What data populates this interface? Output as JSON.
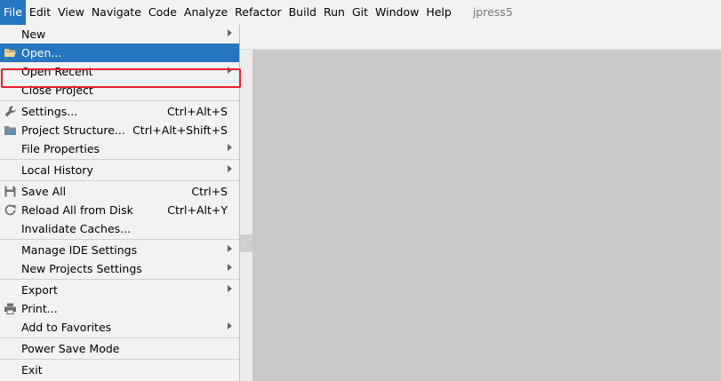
{
  "menubar": {
    "items": [
      "File",
      "Edit",
      "View",
      "Navigate",
      "Code",
      "Analyze",
      "Refactor",
      "Build",
      "Run",
      "Git",
      "Window",
      "Help"
    ],
    "project": "jpress5"
  },
  "file_menu": {
    "new": "New",
    "open": "Open...",
    "open_recent": "Open Recent",
    "close_project": "Close Project",
    "settings": "Settings...",
    "settings_sc": "Ctrl+Alt+S",
    "project_structure": "Project Structure...",
    "project_structure_sc": "Ctrl+Alt+Shift+S",
    "file_properties": "File Properties",
    "local_history": "Local History",
    "save_all": "Save All",
    "save_all_sc": "Ctrl+S",
    "reload": "Reload All from Disk",
    "reload_sc": "Ctrl+Alt+Y",
    "invalidate": "Invalidate Caches...",
    "manage_ide": "Manage IDE Settings",
    "new_projects_settings": "New Projects Settings",
    "export": "Export",
    "print": "Print...",
    "add_favorites": "Add to Favorites",
    "power_save": "Power Save Mode",
    "exit": "Exit"
  },
  "icons": {
    "open": "folder-open-icon",
    "settings": "wrench-icon",
    "project_structure": "project-structure-icon",
    "save_all": "save-icon",
    "reload": "reload-icon",
    "print": "printer-icon"
  },
  "colors": {
    "accent": "#2675bf",
    "highlight_border": "#e8202a",
    "menu_bg": "#f2f2f2",
    "editor_bg": "#c8c8c8"
  }
}
